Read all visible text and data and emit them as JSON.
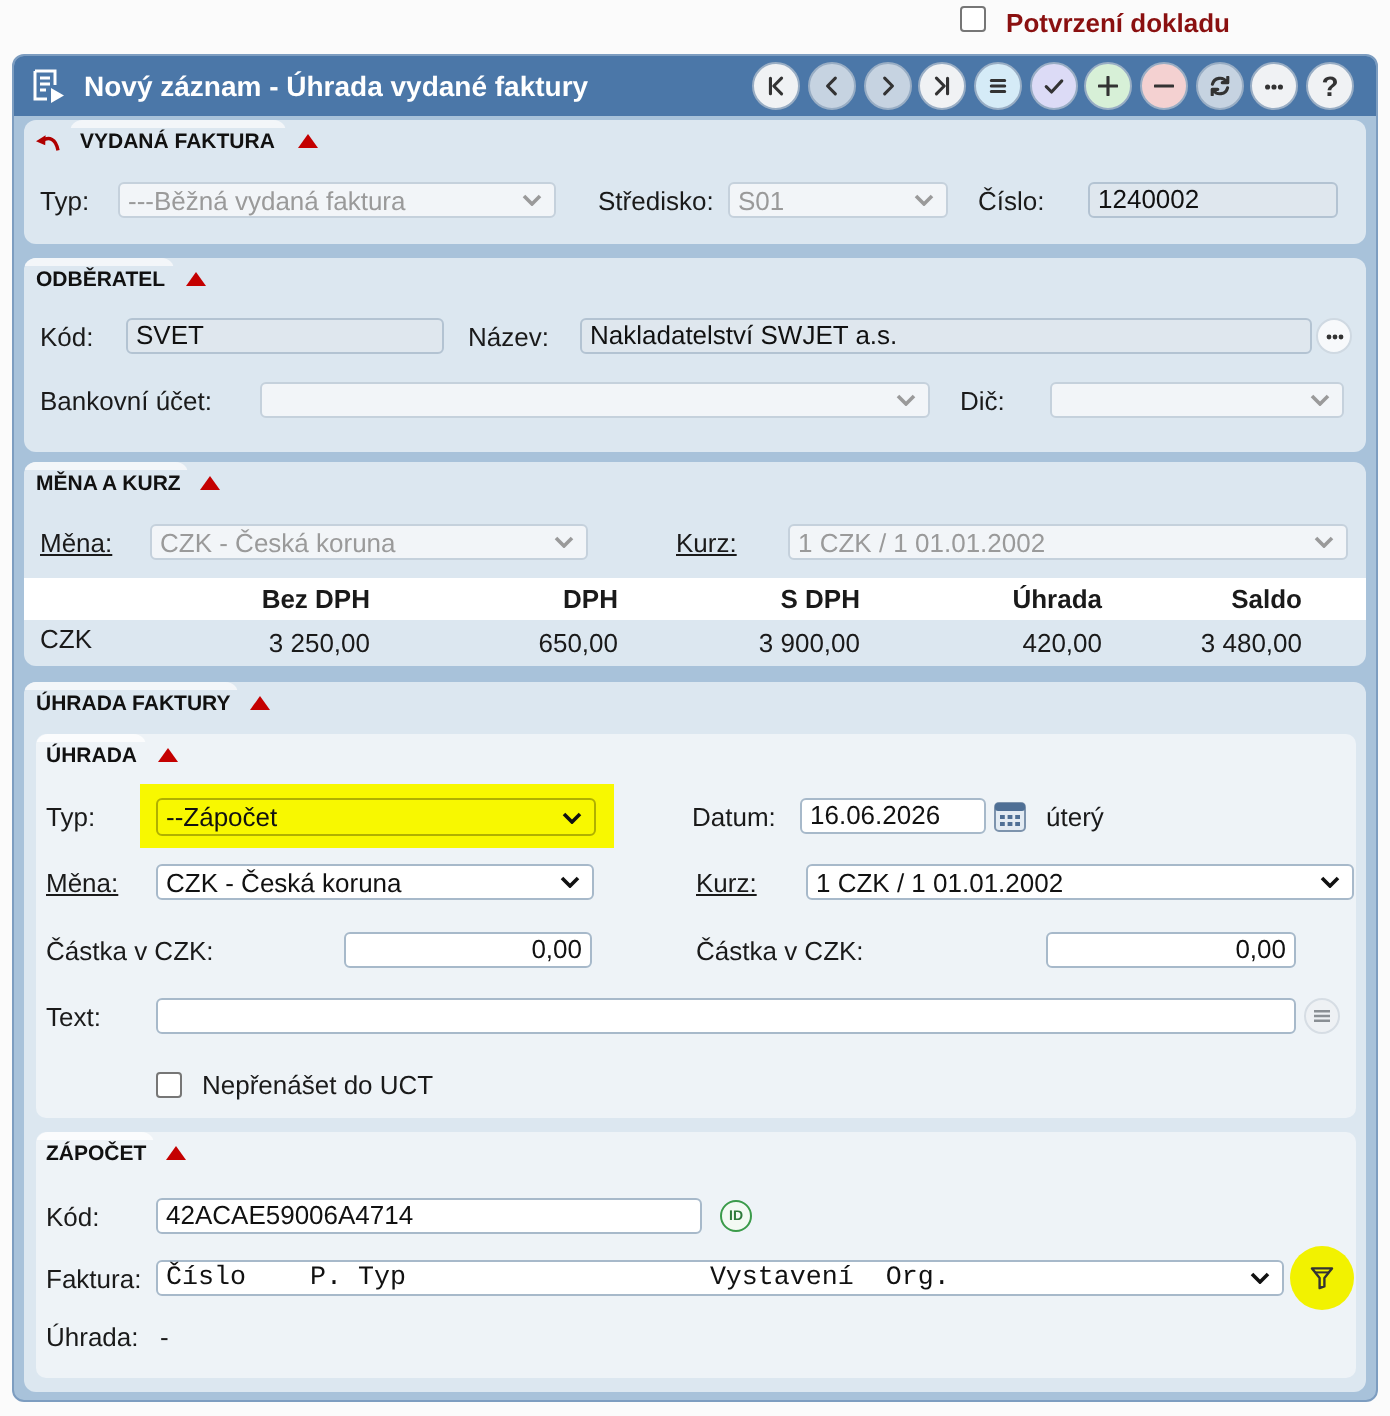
{
  "confirm_document": {
    "label": "Potvrzení dokladu",
    "checked": false
  },
  "window": {
    "title": "Nový záznam - Úhrada vydané faktury"
  },
  "toolbar": [
    {
      "kind": "first",
      "color": "#f0f2f4"
    },
    {
      "kind": "previous",
      "color": "#c6d3e1"
    },
    {
      "kind": "next",
      "color": "#c6d3e1"
    },
    {
      "kind": "last",
      "color": "#f0f2f4"
    },
    {
      "kind": "list",
      "color": "#d5ebf7"
    },
    {
      "kind": "confirm",
      "color": "#dcdbf6"
    },
    {
      "kind": "add",
      "color": "#d7f0d7"
    },
    {
      "kind": "remove",
      "color": "#f4d1d1"
    },
    {
      "kind": "refresh",
      "color": "#c6d3e1"
    },
    {
      "kind": "more",
      "color": "#f0f2f4"
    },
    {
      "kind": "help",
      "label": "?",
      "color": "#f0f2f4"
    }
  ],
  "invoice": {
    "title": "VYDANÁ FAKTURA",
    "expanded": true,
    "type": {
      "label": "Typ:",
      "value": "---Běžná vydaná faktura",
      "disabled": true
    },
    "centre": {
      "label": "Středisko:",
      "value": "S01",
      "disabled": true
    },
    "number": {
      "label": "Číslo:",
      "value": "1240002",
      "readonly": true
    }
  },
  "customer": {
    "title": "ODBĚRATEL",
    "expanded": true,
    "code": {
      "label": "Kód:",
      "value": "SVET",
      "readonly": true
    },
    "name": {
      "label": "Název:",
      "value": "Nakladatelství SWJET a.s.",
      "readonly": true
    },
    "bank_account": {
      "label": "Bankovní účet:",
      "disabled": true
    },
    "tax_id": {
      "label": "Dič:",
      "disabled": true
    }
  },
  "currency": {
    "title": "MĚNA A KURZ",
    "expanded": true,
    "currency": {
      "label": "Měna:",
      "link": true,
      "value": "CZK - Česká koruna",
      "disabled": true
    },
    "rate": {
      "label": "Kurz:",
      "link": true,
      "value": "1 CZK / 1 01.01.2002",
      "disabled": true
    },
    "table": {
      "columns": [
        "Bez DPH",
        "DPH",
        "S DPH",
        "Úhrada",
        "Saldo"
      ],
      "rows": [
        {
          "currency": "CZK",
          "cells": [
            "3 250,00",
            "650,00",
            "3 900,00",
            "420,00",
            "3 480,00"
          ]
        }
      ]
    }
  },
  "payment": {
    "title": "ÚHRADA FAKTURY",
    "expanded": true,
    "payment": {
      "title": "ÚHRADA",
      "expanded": true,
      "type": {
        "label": "Typ:",
        "value": "--Zápočet",
        "disabled": false,
        "highlighted": true
      },
      "date": {
        "label": "Datum:",
        "value": "16.06.2026",
        "readonly": false,
        "weekday": "úterý"
      },
      "currency": {
        "label": "Měna:",
        "link": true,
        "value": "CZK - Česká koruna",
        "disabled": false
      },
      "rate": {
        "label": "Kurz:",
        "link": true,
        "value": "1 CZK / 1 01.01.2002",
        "disabled": false
      },
      "amount": {
        "label": "Částka v CZK:",
        "value": "0,00",
        "readonly": false
      },
      "amount_converted": {
        "label": "Částka v CZK:",
        "value": "0,00",
        "readonly": false
      },
      "text": {
        "label": "Text:",
        "readonly": false
      },
      "no_transfer": {
        "label": "Nepřenášet do UCT",
        "checked": false
      }
    },
    "offset": {
      "title": "ZÁPOČET",
      "expanded": true,
      "code": {
        "label": "Kód:",
        "value": "42ACAE59006A4714",
        "readonly": false,
        "button": "ID"
      },
      "invoice": {
        "label": "Faktura:",
        "value": "Číslo    P. Typ                   Vystavení  Org.",
        "disabled": false,
        "filter_highlighted": true
      },
      "payment": {
        "label": "Úhrada:",
        "value": "-"
      }
    }
  }
}
